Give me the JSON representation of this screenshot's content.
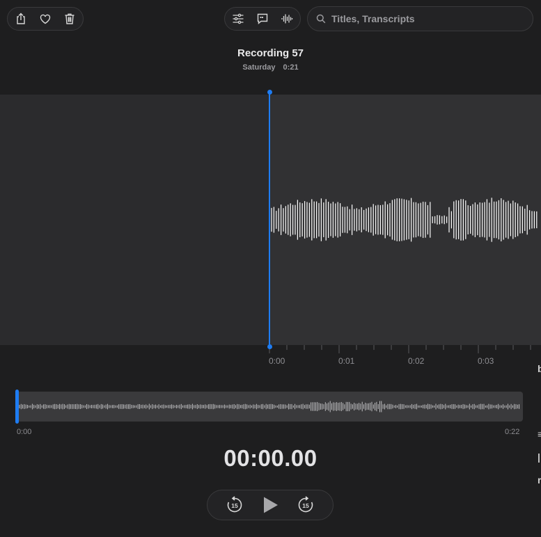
{
  "toolbar": {
    "left": [
      {
        "name": "share-button",
        "icon": "share-icon"
      },
      {
        "name": "favorite-button",
        "icon": "heart-icon"
      },
      {
        "name": "delete-button",
        "icon": "trash-icon"
      }
    ],
    "middle": [
      {
        "name": "options-button",
        "icon": "sliders-icon"
      },
      {
        "name": "transcript-button",
        "icon": "quote-bubble-icon"
      },
      {
        "name": "waveform-button",
        "icon": "waveform-icon"
      }
    ]
  },
  "search": {
    "placeholder": "Titles, Transcripts",
    "value": ""
  },
  "recording": {
    "title": "Recording 57",
    "day": "Saturday",
    "duration": "0:21"
  },
  "timeline": {
    "labels": [
      "0:00",
      "0:01",
      "0:02",
      "0:03"
    ]
  },
  "overview": {
    "start": "0:00",
    "end": "0:22",
    "position": 0
  },
  "player": {
    "time": "00:00.00",
    "skip_back_seconds": "15",
    "skip_forward_seconds": "15"
  },
  "colors": {
    "accent": "#1e7cf2",
    "background": "#1e1e1f",
    "waveform": "#ffffff"
  }
}
